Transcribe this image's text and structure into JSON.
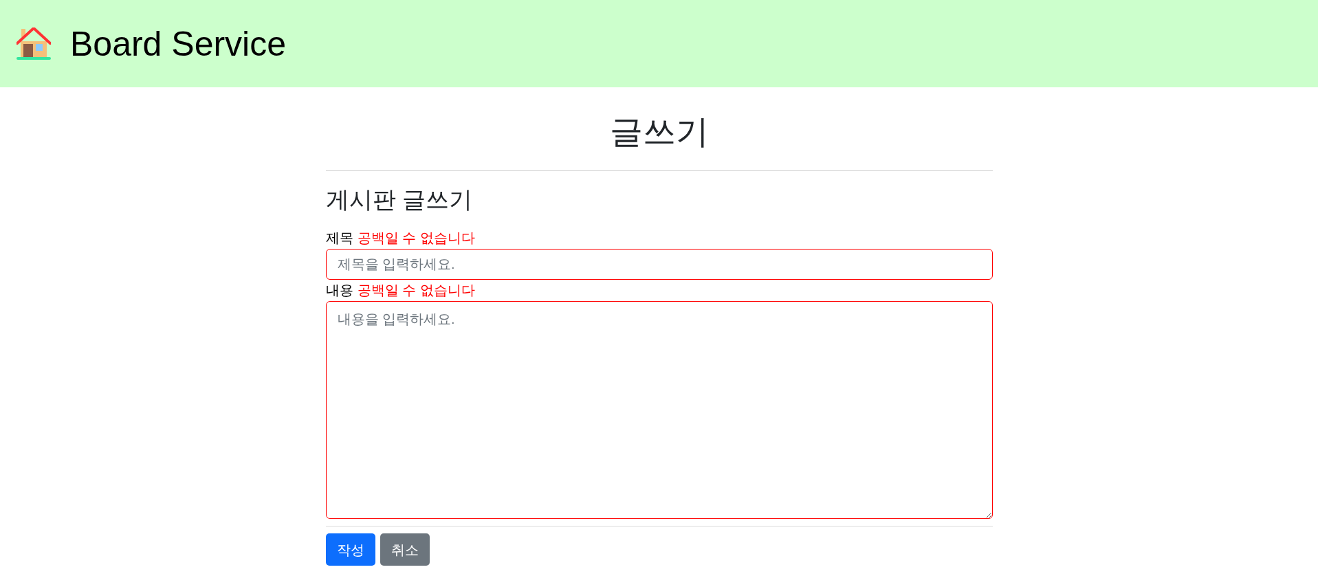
{
  "header": {
    "title": "Board Service"
  },
  "page_title": "글쓰기",
  "form": {
    "heading": "게시판 글쓰기",
    "fields": [
      {
        "kind": "input",
        "label": "제목",
        "error": "공백일 수 없습니다",
        "placeholder": "제목을 입력하세요.",
        "invalid": true
      },
      {
        "kind": "textarea",
        "label": "내용",
        "error": "공백일 수 없습니다",
        "placeholder": "내용을 입력하세요.",
        "invalid": true
      }
    ],
    "buttons": [
      {
        "label": "작성",
        "kind": "primary"
      },
      {
        "label": "취소",
        "kind": "secondary"
      }
    ]
  }
}
